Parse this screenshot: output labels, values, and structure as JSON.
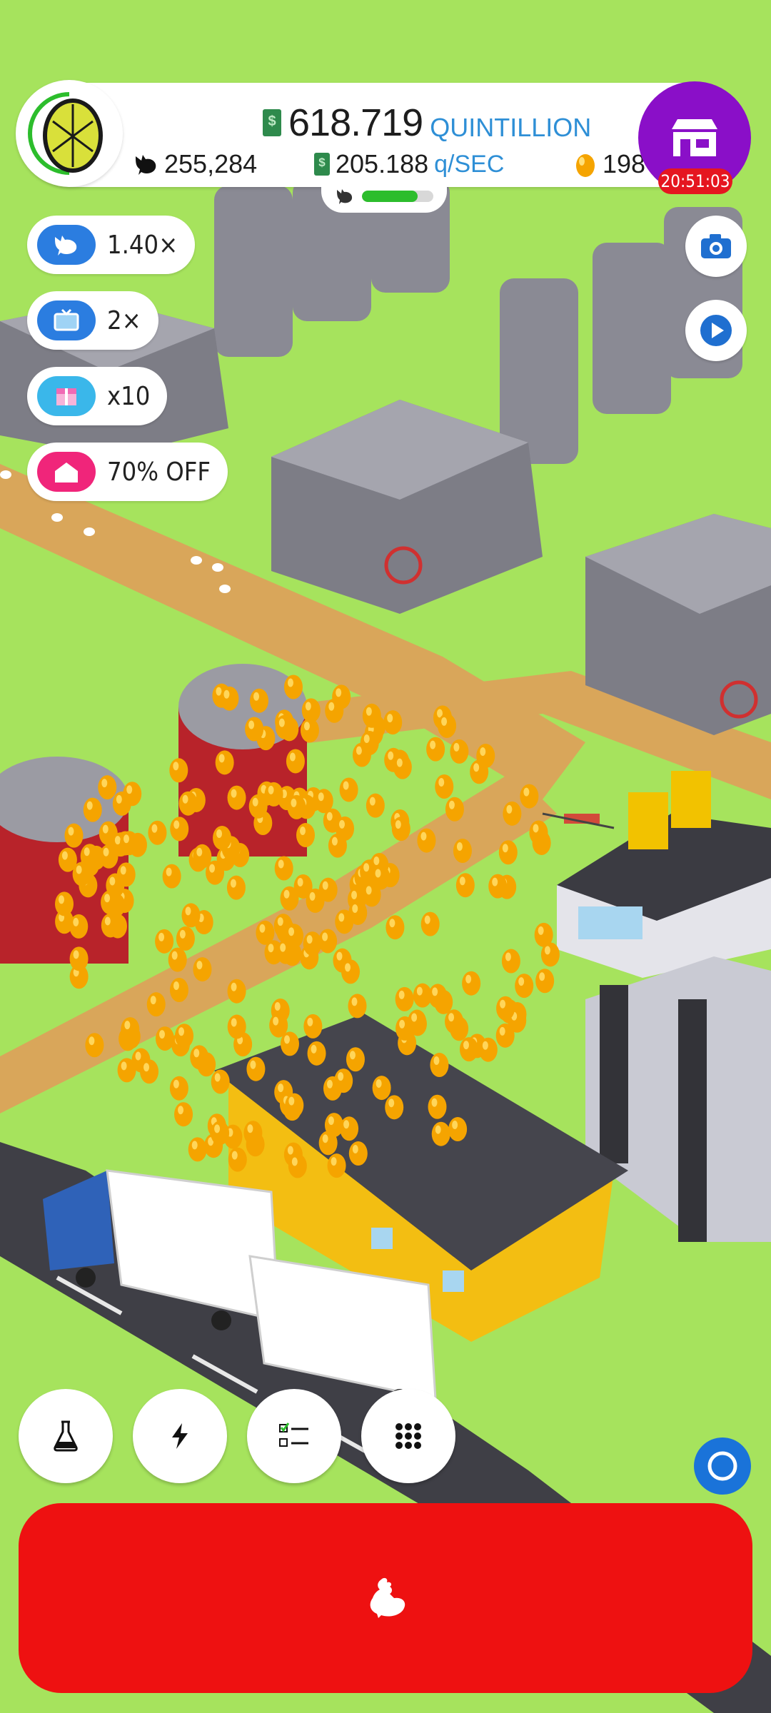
{
  "stats": {
    "money_value": "618.719",
    "money_unit": "QUINTILLION",
    "income_value": "205.188",
    "income_unit": "q/SEC",
    "chicken_count": "255,284",
    "golden_eggs": "198"
  },
  "hatchery": {
    "fill_fraction": 0.78
  },
  "shop": {
    "timer": "20:51:03"
  },
  "boosts": [
    {
      "label": "1.40×",
      "icon": "chicken-boost-icon",
      "color": "#2b7de0"
    },
    {
      "label": "2×",
      "icon": "tv-ad-icon",
      "color": "#2b7de0"
    },
    {
      "label": "x10",
      "icon": "gift-box-icon",
      "color": "#3ab7ea"
    },
    {
      "label": "70% OFF",
      "icon": "house-discount-icon",
      "color": "#f0257a"
    }
  ],
  "colors": {
    "grass": "#a6e35d",
    "road": "#d9a65a",
    "shop": "#8a0fc8",
    "hatch_button": "#ee1111",
    "accent_blue": "#2e8fd6"
  },
  "toolbar": [
    "research-icon",
    "boost-icon",
    "quests-icon",
    "menu-grid-icon"
  ]
}
